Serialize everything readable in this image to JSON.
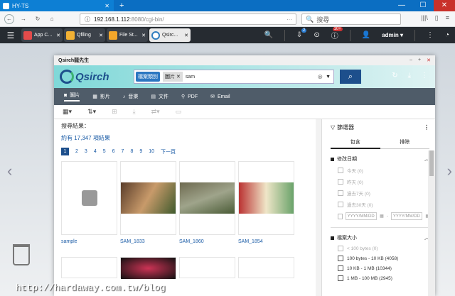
{
  "browser": {
    "tab_title": "HY-TS",
    "new_tab": "+",
    "url_prefix": "192.168.1.112",
    "url_rest": ":8080/cgi-bin/",
    "search_placeholder": "搜尋"
  },
  "qts": {
    "apps": [
      {
        "label": "App C...",
        "color": "#e24b4b"
      },
      {
        "label": "Qfiling",
        "color": "#f2b134"
      },
      {
        "label": "File St...",
        "color": "#f3a72a"
      },
      {
        "label": "Qsirc...",
        "color": "#2f7dbf"
      }
    ],
    "notif_count": "2",
    "alert_count": "10+",
    "user": "admin ▾"
  },
  "qsirch": {
    "window_title": "Qsirch龍先生",
    "logo": "Qsirch",
    "chip_category": "檔案類別",
    "chip_value": "圖片",
    "query": "sam",
    "categories": [
      {
        "label": "圖片",
        "icon": "camera-icon"
      },
      {
        "label": "影片",
        "icon": "film-icon"
      },
      {
        "label": "音樂",
        "icon": "music-icon"
      },
      {
        "label": "文件",
        "icon": "document-icon"
      },
      {
        "label": "PDF",
        "icon": "pdf-icon"
      },
      {
        "label": "Email",
        "icon": "email-icon"
      }
    ],
    "results_title": "搜尋結果：",
    "results_count": "約有 17,347 項結果",
    "pages": [
      "1",
      "2",
      "3",
      "4",
      "5",
      "6",
      "7",
      "8",
      "9",
      "10",
      "下一頁"
    ],
    "items": [
      {
        "name": "sample"
      },
      {
        "name": "SAM_1833"
      },
      {
        "name": "SAM_1860"
      },
      {
        "name": "SAM_1854"
      }
    ],
    "filter": {
      "title": "篩選器",
      "tab_include": "包含",
      "tab_exclude": "排除",
      "date_section": "修改日期",
      "date_options": [
        "今天 (0)",
        "昨天 (0)",
        "過去7天 (0)",
        "過去30天 (0)"
      ],
      "date_from": "YYYY/MM/DD",
      "date_to": "YYYY/MM/DD",
      "size_section": "檔案大小",
      "size_options": [
        "< 100 bytes (0)",
        "100 bytes - 10 KB (4058)",
        "10 KB - 1 MB (10344)",
        "1 MB - 100 MB (2945)"
      ]
    }
  },
  "watermark": "http://hardaway.com.tw/blog"
}
